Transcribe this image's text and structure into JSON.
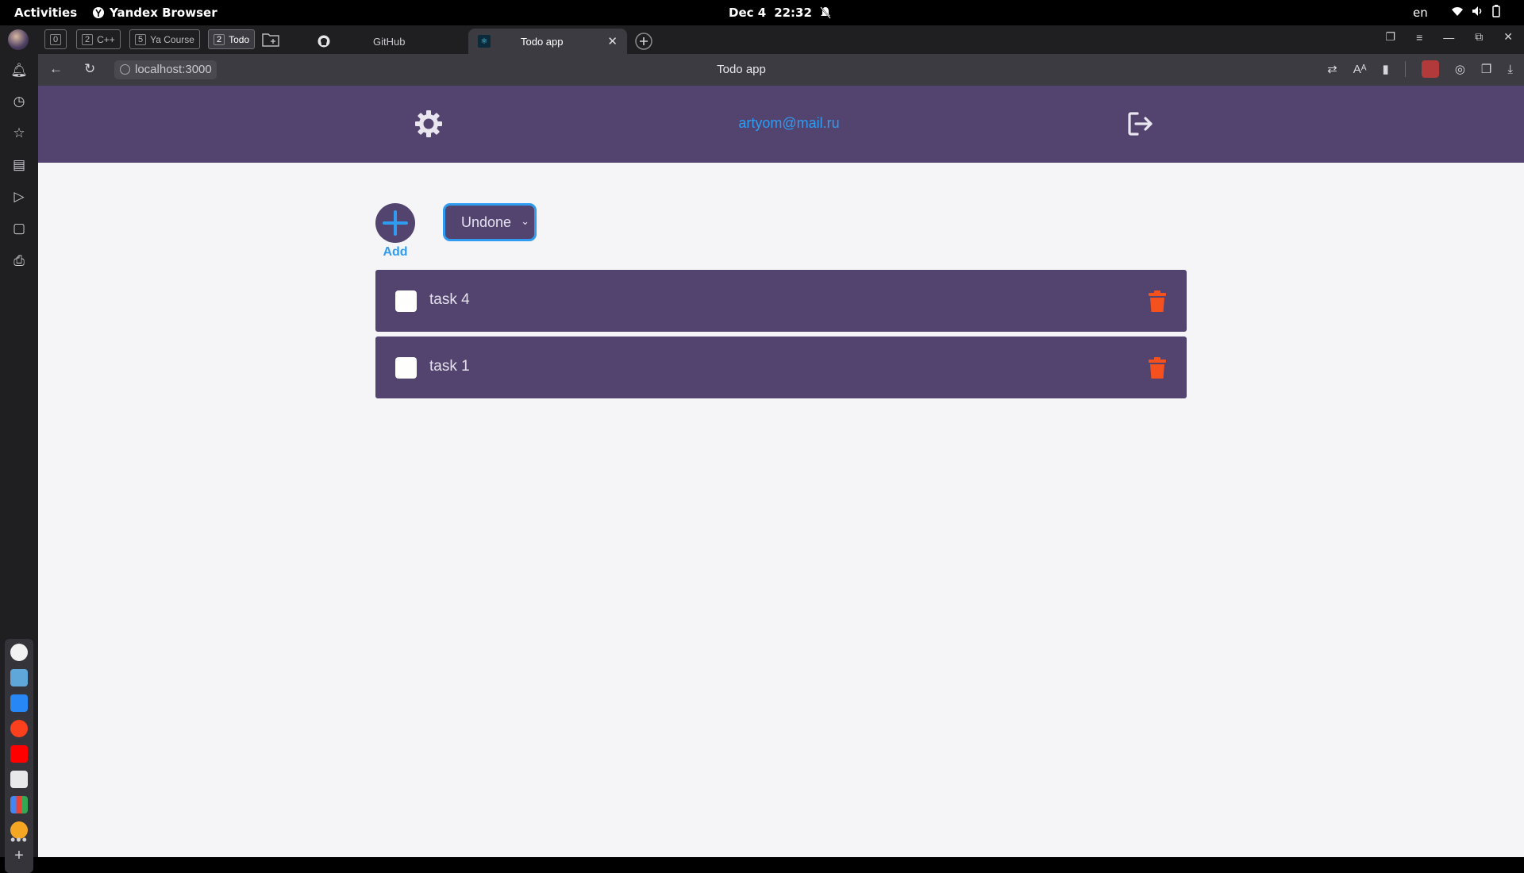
{
  "system": {
    "activities": "Activities",
    "app_name": "Yandex Browser",
    "date": "Dec 4",
    "time": "22:32",
    "language": "en"
  },
  "tabs": {
    "group_home_num": "0",
    "group_cpp_num": "2",
    "group_cpp_label": "C++",
    "group_course_num": "5",
    "group_course_label": "Ya Course",
    "group_todo_num": "2",
    "group_todo_label": "Todo",
    "github_tab": "GitHub",
    "active_tab": "Todo app"
  },
  "toolbar": {
    "url": "localhost:3000",
    "page_title": "Todo app"
  },
  "app": {
    "user_email": "artyom@mail.ru",
    "add_label": "Add",
    "filter_value": "Undone",
    "tasks": [
      {
        "name": "task 4",
        "done": false
      },
      {
        "name": "task 1",
        "done": false
      }
    ]
  },
  "colors": {
    "header_bg": "#52446f",
    "accent_blue": "#2f9cf2",
    "trash_red": "#f4511e",
    "page_bg": "#f5f5f7"
  }
}
